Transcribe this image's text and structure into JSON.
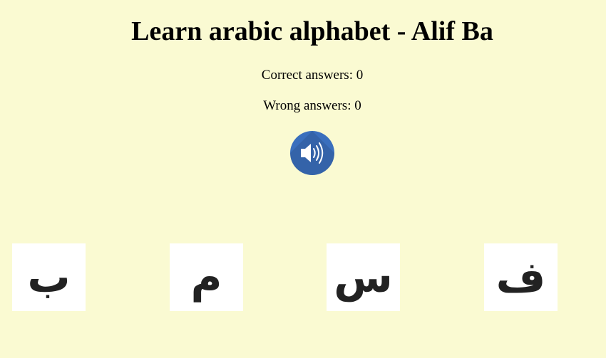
{
  "header": {
    "title": "Learn arabic alphabet - Alif Ba"
  },
  "stats": {
    "correct": "Correct answers: 0",
    "wrong": "Wrong answers: 0"
  },
  "sound_button": {
    "icon": "speaker-icon",
    "color": "#3a6fbd"
  },
  "letters": [
    {
      "char": "ب"
    },
    {
      "char": "م"
    },
    {
      "char": "س"
    },
    {
      "char": "ف"
    }
  ],
  "colors": {
    "background": "#fafad2",
    "card": "#ffffff"
  }
}
